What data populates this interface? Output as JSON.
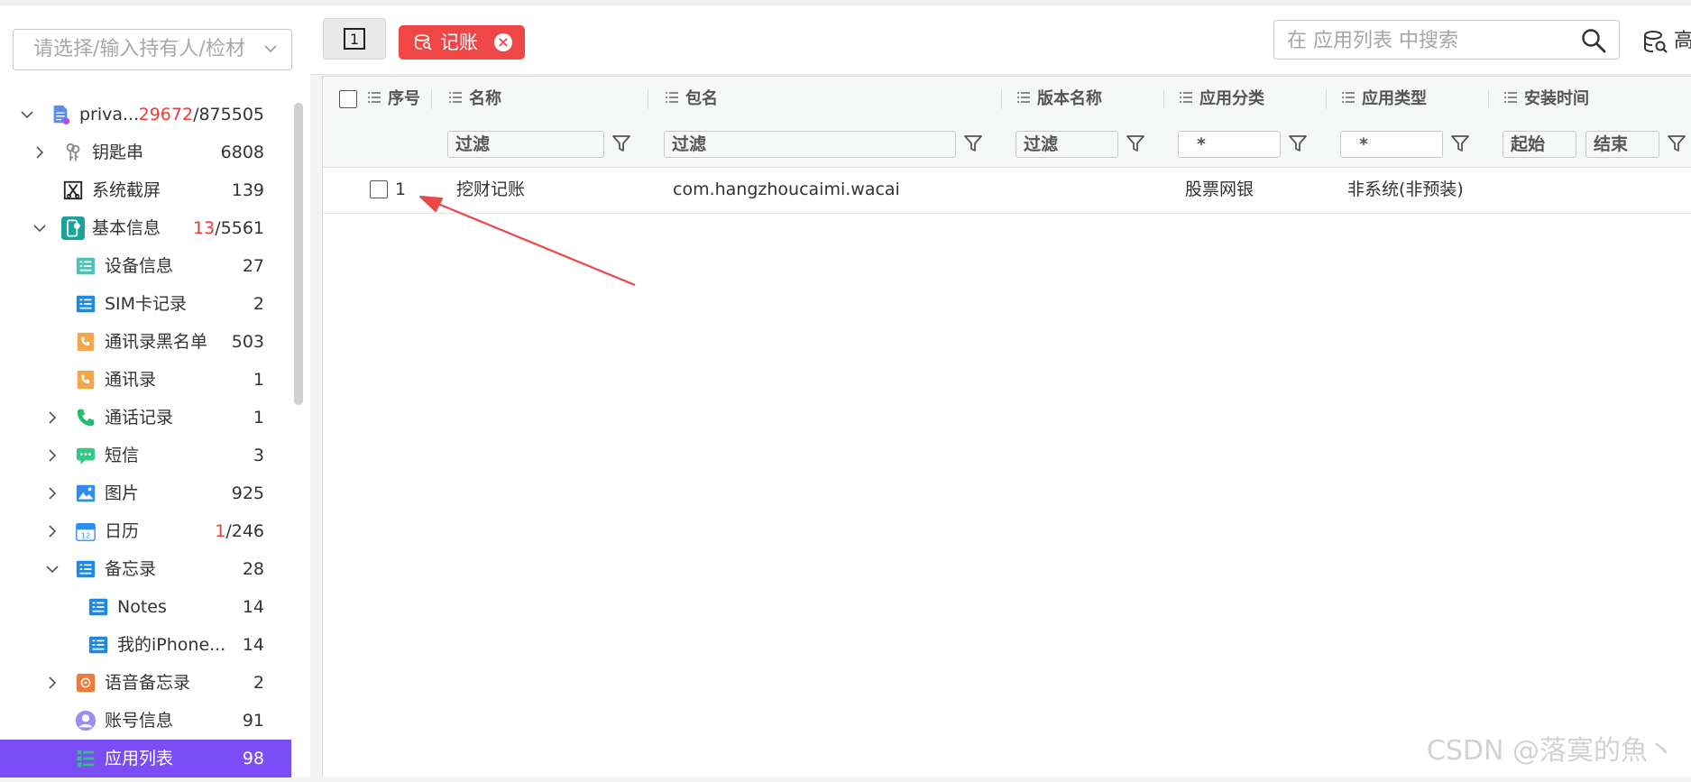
{
  "owner_select": {
    "placeholder": "请选择/输入持有人/检材"
  },
  "tree": [
    {
      "label": "priva...",
      "count_red": "29672",
      "count_sep": "/",
      "count": "875505",
      "icon": "doc-icon",
      "indent": 0,
      "expand": "expanded"
    },
    {
      "label": "钥匙串",
      "count": "6808",
      "icon": "keys-icon",
      "indent": 1,
      "expand": "collapsed"
    },
    {
      "label": "系统截屏",
      "count": "139",
      "icon": "screenshot-icon",
      "indent": 1,
      "expand": "none"
    },
    {
      "label": "基本信息",
      "count_red": "13",
      "count_sep": "/",
      "count": "5561",
      "icon": "phone-info-icon",
      "indent": 1,
      "expand": "expanded"
    },
    {
      "label": "设备信息",
      "count": "27",
      "icon": "device-icon",
      "indent": 2,
      "expand": "none"
    },
    {
      "label": "SIM卡记录",
      "count": "2",
      "icon": "sim-icon",
      "indent": 2,
      "expand": "none"
    },
    {
      "label": "通讯录黑名单",
      "count": "503",
      "icon": "contact-block-icon",
      "indent": 2,
      "expand": "none"
    },
    {
      "label": "通讯录",
      "count": "1",
      "icon": "contact-icon",
      "indent": 2,
      "expand": "none"
    },
    {
      "label": "通话记录",
      "count": "1",
      "icon": "call-icon",
      "indent": 2,
      "expand": "collapsed"
    },
    {
      "label": "短信",
      "count": "3",
      "icon": "sms-icon",
      "indent": 2,
      "expand": "collapsed"
    },
    {
      "label": "图片",
      "count": "925",
      "icon": "image-icon",
      "indent": 2,
      "expand": "collapsed"
    },
    {
      "label": "日历",
      "count_red": "1",
      "count_sep": "/",
      "count": "246",
      "icon": "calendar-icon",
      "indent": 2,
      "expand": "collapsed"
    },
    {
      "label": "备忘录",
      "count": "28",
      "icon": "memo-icon",
      "indent": 2,
      "expand": "expanded"
    },
    {
      "label": "Notes",
      "count": "14",
      "icon": "memo-icon",
      "indent": 3,
      "expand": "none"
    },
    {
      "label": "我的iPhone...",
      "count": "14",
      "icon": "memo-icon",
      "indent": 3,
      "expand": "none"
    },
    {
      "label": "语音备忘录",
      "count": "2",
      "icon": "voice-memo-icon",
      "indent": 2,
      "expand": "collapsed"
    },
    {
      "label": "账号信息",
      "count": "91",
      "icon": "account-icon",
      "indent": 2,
      "expand": "none"
    },
    {
      "label": "应用列表",
      "count": "98",
      "icon": "app-list-icon",
      "indent": 2,
      "expand": "none",
      "selected": true
    }
  ],
  "header": {
    "window_label": "1",
    "filter_chip": {
      "label": "记账",
      "close": "×"
    },
    "search": {
      "placeholder": "在 应用列表 中搜索"
    },
    "advanced_label": "高"
  },
  "table": {
    "columns": [
      "序号",
      "名称",
      "包名",
      "版本名称",
      "应用分类",
      "应用类型",
      "安装时间"
    ],
    "filters": {
      "name": "过滤",
      "package": "过滤",
      "version": "过滤",
      "category": "*",
      "type": "*",
      "time_start": "起始",
      "time_end": "结束"
    },
    "rows": [
      {
        "index": "1",
        "name": "挖财记账",
        "package": "com.hangzhoucaimi.wacai",
        "version": "",
        "category": "股票网银",
        "type": "非系统(非预装)",
        "install_time": ""
      }
    ]
  },
  "watermark": "CSDN @落寞的魚丶",
  "colors": {
    "accent": "#7a4df7",
    "chip": "#ef4646",
    "annotation_arrow": "#e8484a",
    "red_count": "#ef3b3b"
  }
}
